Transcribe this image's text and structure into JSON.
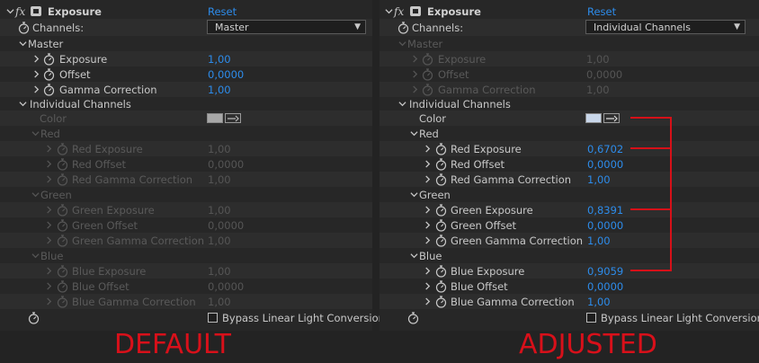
{
  "effect": {
    "fx": "fx",
    "title": "Exposure",
    "reset": "Reset",
    "channels_label": "Channels:",
    "master_label": "Master",
    "individual_label": "Individual Channels",
    "color_label": "Color",
    "red_label": "Red",
    "green_label": "Green",
    "blue_label": "Blue",
    "exposure_label": "Exposure",
    "offset_label": "Offset",
    "gamma_label": "Gamma Correction",
    "red_exposure_label": "Red Exposure",
    "red_offset_label": "Red Offset",
    "red_gamma_label": "Red Gamma Correction",
    "green_exposure_label": "Green Exposure",
    "green_offset_label": "Green Offset",
    "green_gamma_label": "Green Gamma Correction",
    "blue_exposure_label": "Blue Exposure",
    "blue_offset_label": "Blue Offset",
    "blue_gamma_label": "Blue Gamma Correction",
    "bypass_label": "Bypass Linear Light Conversion"
  },
  "left": {
    "channels_value": "Master",
    "master": {
      "exposure": "1,00",
      "offset": "0,0000",
      "gamma": "1,00"
    },
    "swatch_color": "#a8a8a8",
    "red": {
      "exposure": "1,00",
      "offset": "0,0000",
      "gamma": "1,00"
    },
    "green": {
      "exposure": "1,00",
      "offset": "0,0000",
      "gamma": "1,00"
    },
    "blue": {
      "exposure": "1,00",
      "offset": "0,0000",
      "gamma": "1,00"
    },
    "caption": "DEFAULT"
  },
  "right": {
    "channels_value": "Individual Channels",
    "master": {
      "exposure": "1,00",
      "offset": "0,0000",
      "gamma": "1,00"
    },
    "swatch_color": "#c9d7ea",
    "red": {
      "exposure": "0,6702",
      "offset": "0,0000",
      "gamma": "1,00"
    },
    "green": {
      "exposure": "0,8391",
      "offset": "0,0000",
      "gamma": "1,00"
    },
    "blue": {
      "exposure": "0,9059",
      "offset": "0,0000",
      "gamma": "1,00"
    },
    "caption": "ADJUSTED"
  },
  "colors": {
    "value_blue": "#2d8ceb",
    "annotation_red": "#d61018",
    "dimmed": "#5a5a5a"
  }
}
